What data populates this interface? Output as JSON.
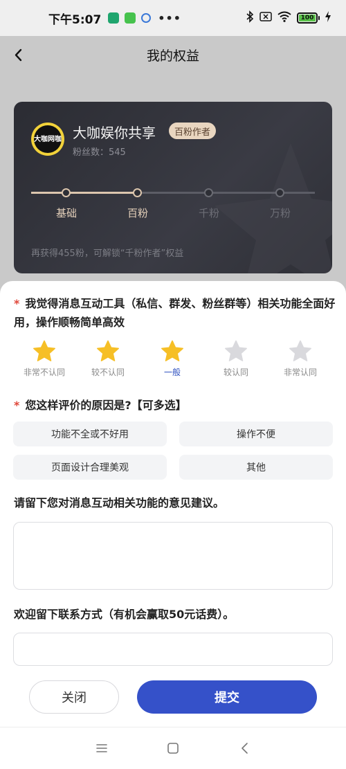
{
  "status_bar": {
    "time": "下午5:07",
    "more": "•••",
    "battery": "100",
    "icons": [
      "app-shield-icon",
      "app-chat-icon",
      "app-paw-icon",
      "bluetooth-icon",
      "sim-x-icon",
      "wifi-icon",
      "battery-icon",
      "charging-icon"
    ]
  },
  "nav": {
    "title": "我的权益",
    "back_icon": "back-arrow-icon"
  },
  "card": {
    "avatar_text": "大咖网咖",
    "name": "大咖娱你共享",
    "badge": "百粉作者",
    "fans": "粉丝数：545",
    "levels": [
      {
        "label": "基础",
        "active": true
      },
      {
        "label": "百粉",
        "active": true
      },
      {
        "label": "千粉",
        "active": false
      },
      {
        "label": "万粉",
        "active": false
      }
    ],
    "hint": "再获得455粉，可解锁“千粉作者”权益"
  },
  "survey": {
    "q1_required": "*",
    "q1_text": "我觉得消息互动工具（私信、群发、粉丝群等）相关功能全面好用，操作顺畅简单高效",
    "rating": {
      "selected": 3,
      "items": [
        "非常不认同",
        "较不认同",
        "一般",
        "较认同",
        "非常认同"
      ]
    },
    "q2_required": "*",
    "q2_text": "您这样评价的原因是?【可多选】",
    "reasons": [
      "功能不全或不好用",
      "操作不便",
      "页面设计合理美观",
      "其他"
    ],
    "q3_text": "请留下您对消息互动相关功能的意见建议。",
    "q4_text": "欢迎留下联系方式（有机会赢取50元话费）。",
    "close_label": "关闭",
    "submit_label": "提交"
  },
  "colors": {
    "accent": "#3551c9",
    "star_active": "#f6bf26",
    "star_inactive": "#d9d9dd",
    "required": "#e0473a"
  }
}
